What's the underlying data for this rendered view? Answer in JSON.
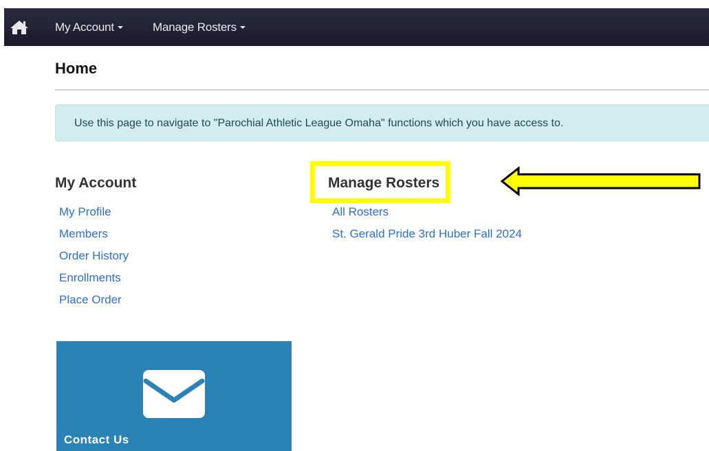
{
  "nav": {
    "home_icon": "home-icon",
    "items": [
      {
        "label": "My Account"
      },
      {
        "label": "Manage Rosters"
      }
    ]
  },
  "page": {
    "title": "Home",
    "info": "Use this page to navigate to \"Parochial Athletic League Omaha\" functions which you have access to."
  },
  "sections": {
    "my_account": {
      "heading": "My Account",
      "links": [
        "My Profile",
        "Members",
        "Order History",
        "Enrollments",
        "Place Order"
      ]
    },
    "manage_rosters": {
      "heading": "Manage Rosters",
      "links": [
        "All Rosters",
        "St. Gerald Pride 3rd Huber Fall 2024"
      ]
    }
  },
  "tiles": {
    "contact": {
      "label": "Contact Us",
      "icon": "envelope-icon"
    }
  },
  "annotation": {
    "highlight_color": "#ffff00",
    "arrow_icon": "left-arrow-icon"
  },
  "colors": {
    "navbar": "#1b1b2b",
    "link": "#2a6fd1",
    "info_bg": "#d3ecf0",
    "tile": "#2a82b6"
  }
}
